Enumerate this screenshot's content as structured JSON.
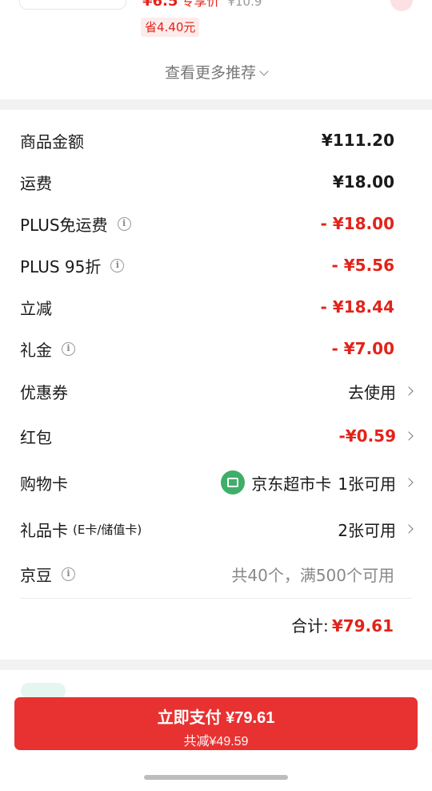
{
  "recommend": {
    "price": "¥6.5",
    "tag": "专享价",
    "original_price": "¥10.9",
    "save_badge": "省4.40元",
    "more_label": "查看更多推荐"
  },
  "summary": {
    "rows": [
      {
        "label": "商品金额",
        "value": "¥111.20"
      },
      {
        "label": "运费",
        "value": "¥18.00"
      },
      {
        "label": "PLUS免运费",
        "value": "- ¥18.00"
      },
      {
        "label": "PLUS 95折",
        "value": "- ¥5.56"
      },
      {
        "label": "立减",
        "value": "- ¥18.44"
      },
      {
        "label": "礼金",
        "value": "- ¥7.00"
      },
      {
        "label": "优惠券",
        "value": "去使用"
      },
      {
        "label": "红包",
        "value": "-¥0.59"
      },
      {
        "label": "购物卡",
        "card_name": "京东超市卡",
        "value": "1张可用"
      },
      {
        "label": "礼品卡",
        "sub": "(E卡/储值卡)",
        "value": "2张可用"
      },
      {
        "label": "京豆",
        "value": "共40个，满500个可用"
      }
    ],
    "total_label": "合计:",
    "total_value": "¥79.61"
  },
  "pay": {
    "main": "立即支付 ¥79.61",
    "sub": "共减¥49.59"
  },
  "colors": {
    "accent": "#e2231a",
    "button": "#e83232",
    "jd_green": "#3fae69"
  }
}
